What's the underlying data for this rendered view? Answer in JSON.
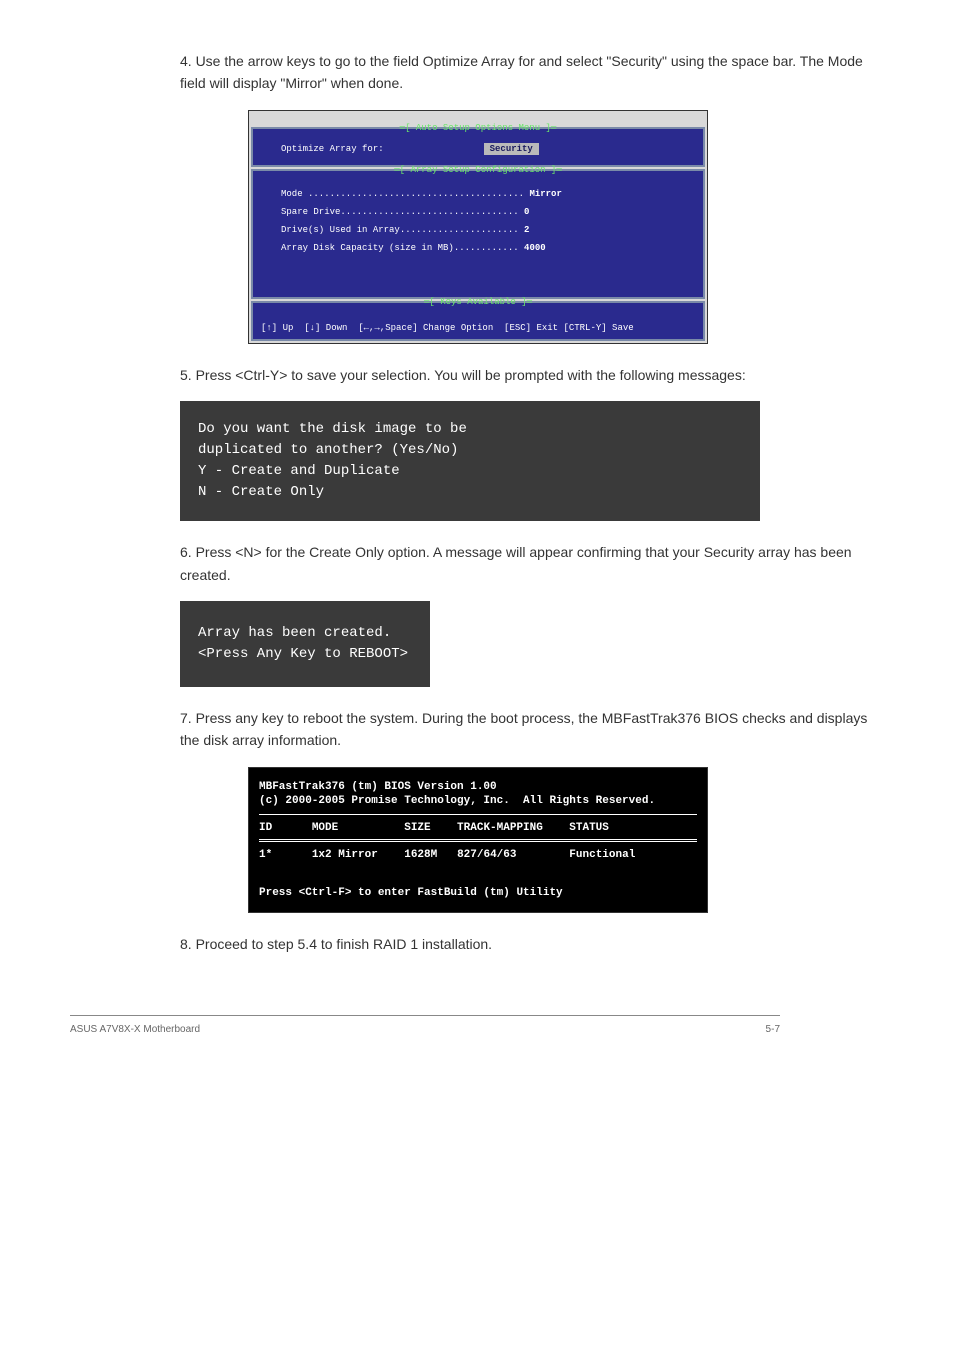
{
  "step4": "4.   Use the arrow keys to go to the field Optimize Array for and select \"Security\" using the space bar. The Mode field will display \"Mirror\" when done.",
  "bios1": {
    "panel1_title": "Auto Setup Options Menu",
    "optimize_label": "Optimize Array for:",
    "optimize_value": "Security",
    "panel2_title": "Array Setup Configuration",
    "cfg": {
      "mode_label": "Mode ........................................",
      "mode_value": "Mirror",
      "spare_label": "Spare Drive.................................",
      "spare_value": "0",
      "drives_label": "Drive(s) Used in Array......................",
      "drives_value": "2",
      "capacity_label": "Array Disk Capacity (size in MB)............",
      "capacity_value": "4000"
    },
    "panel3_title": "Keys Available",
    "keys_line": "[↑] Up  [↓] Down  [←,→,Space] Change Option  [ESC] Exit [CTRL-Y] Save"
  },
  "step5": "5.   Press <Ctrl-Y> to save your selection. You will be prompted with the following messages:",
  "darkbox1_l1": "Do you want the disk image to be",
  "darkbox1_l2": "duplicated to another? (Yes/No)",
  "darkbox1_l3": "Y - Create and Duplicate",
  "darkbox1_l4": "N - Create Only",
  "step6": "6.   Press <N> for the Create Only option. A message will appear confirming that your Security array has been created.",
  "darkbox2_l1": "Array has been created.",
  "darkbox2_l2": "<Press Any Key to REBOOT>",
  "step7": "7.   Press any key to reboot the system. During the boot process, the MBFastTrak376 BIOS checks and displays the disk array information.",
  "bios2": {
    "title": "MBFastTrak376 (tm) BIOS Version 1.00",
    "copyright": "(c) 2000-2005 Promise Technology, Inc.  All Rights Reserved.",
    "hdr_id": "ID",
    "hdr_mode": "MODE",
    "hdr_size": "SIZE",
    "hdr_track": "TRACK-MAPPING",
    "hdr_status": "STATUS",
    "row_id": "1*",
    "row_mode": "1x2 Mirror",
    "row_size": "1628M",
    "row_track": "827/64/63",
    "row_status": "Functional",
    "footer": "Press <Ctrl-F> to enter FastBuild (tm) Utility"
  },
  "step8": "8.   Proceed to step 5.4 to finish RAID 1 installation.",
  "footer_left": "ASUS A7V8X-X Motherboard",
  "footer_right": "5-7"
}
